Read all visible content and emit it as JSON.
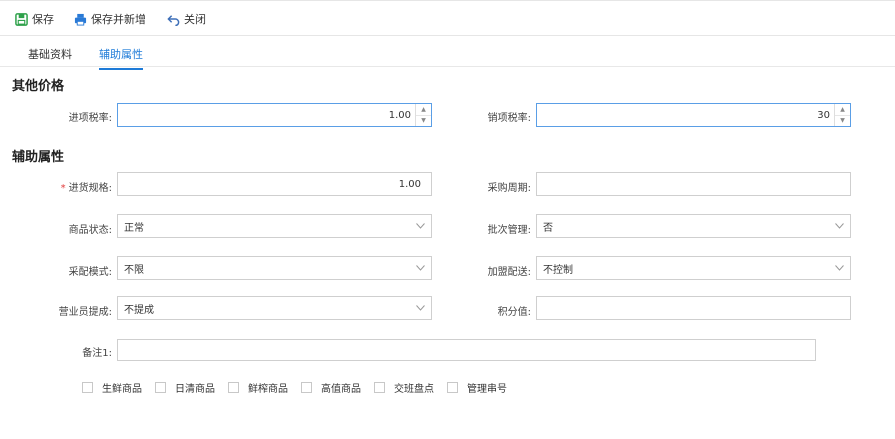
{
  "toolbar": {
    "save_label": "保存",
    "save_new_label": "保存并新增",
    "close_label": "关闭",
    "save_icon_color": "#2ea14a",
    "print_icon_color": "#2a7ad6"
  },
  "tabs": [
    {
      "label": "基础资料",
      "active": false
    },
    {
      "label": "辅助属性",
      "active": true
    }
  ],
  "accent_color": "#1e7bd8",
  "sections": {
    "price": {
      "title": "其他价格",
      "input_tax": {
        "label": "进项税率:",
        "value": "1.00"
      },
      "output_tax": {
        "label": "销项税率:",
        "value": "30"
      }
    },
    "aux": {
      "title": "辅助属性",
      "purchase_spec": {
        "label": "进货规格:",
        "value": "1.00",
        "required": "*"
      },
      "purchase_cycle": {
        "label": "采购周期:",
        "value": ""
      },
      "product_status": {
        "label": "商品状态:",
        "value": "正常"
      },
      "batch_mgmt": {
        "label": "批次管理:",
        "value": "否"
      },
      "distribution_mode": {
        "label": "采配模式:",
        "value": "不限"
      },
      "franchise_delivery": {
        "label": "加盟配送:",
        "value": "不控制"
      },
      "sales_commission": {
        "label": "营业员提成:",
        "value": "不提成"
      },
      "points": {
        "label": "积分值:",
        "value": ""
      },
      "remark": {
        "label": "备注1:",
        "value": ""
      }
    }
  },
  "checkboxes": [
    {
      "label": "生鲜商品",
      "checked": false
    },
    {
      "label": "日清商品",
      "checked": false
    },
    {
      "label": "鲜榨商品",
      "checked": false
    },
    {
      "label": "高值商品",
      "checked": false
    },
    {
      "label": "交班盘点",
      "checked": false
    },
    {
      "label": "管理串号",
      "checked": false
    }
  ]
}
